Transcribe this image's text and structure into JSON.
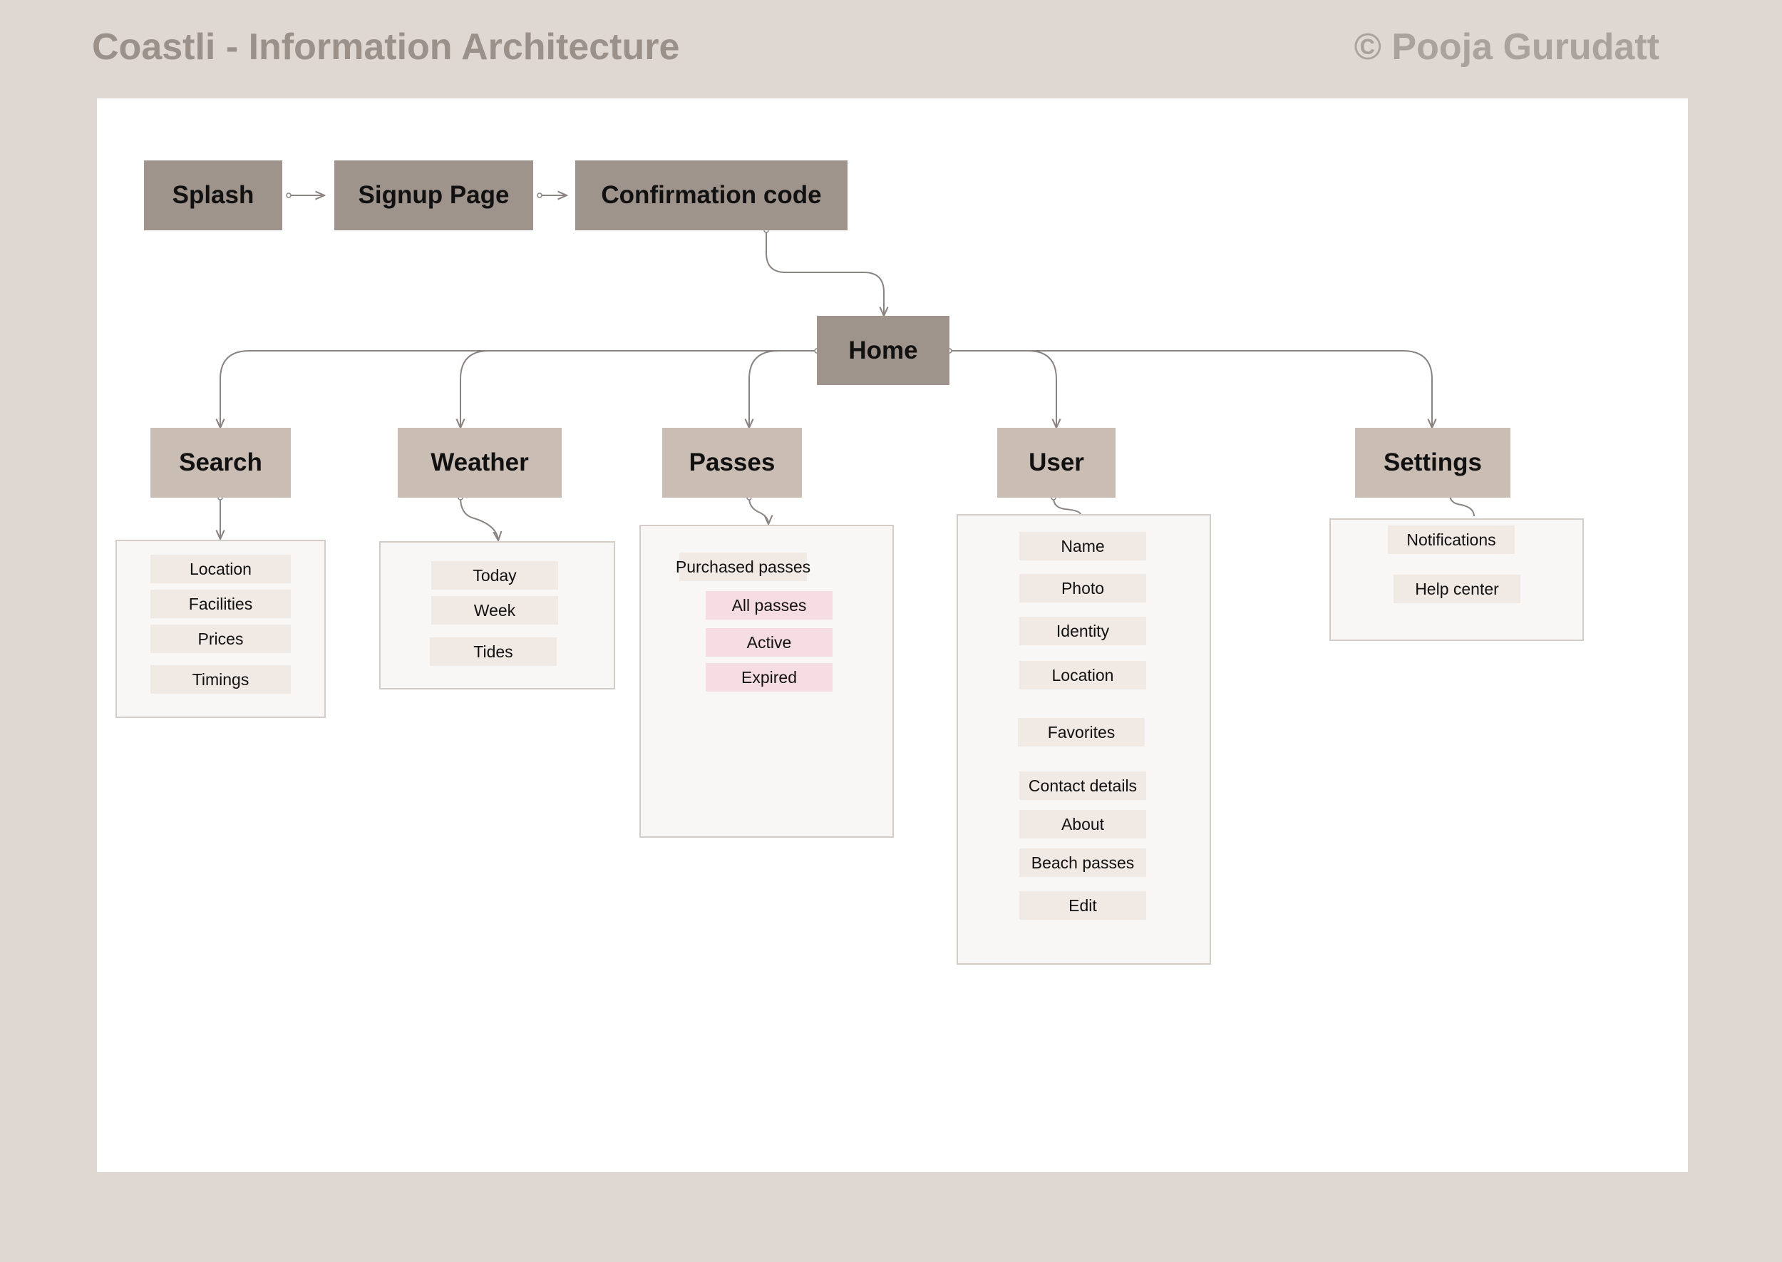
{
  "header": {
    "title": "Coastli - Information Architecture",
    "credit": "© Pooja Gurudatt"
  },
  "flow": {
    "splash": "Splash",
    "signup": "Signup Page",
    "confirmation": "Confirmation code",
    "home": "Home"
  },
  "sections": {
    "search": {
      "label": "Search",
      "items": [
        "Location",
        "Facilities",
        "Prices",
        "Timings"
      ]
    },
    "weather": {
      "label": "Weather",
      "items": [
        "Today",
        "Week",
        "Tides"
      ]
    },
    "passes": {
      "label": "Passes",
      "group_label": "Purchased passes",
      "items": [
        "All passes",
        "Active",
        "Expired"
      ]
    },
    "user": {
      "label": "User",
      "items": [
        "Name",
        "Photo",
        "Identity",
        "Location",
        "Favorites",
        "Contact details",
        "About",
        "Beach passes",
        "Edit"
      ]
    },
    "settings": {
      "label": "Settings",
      "items": [
        "Notifications",
        "Help center"
      ]
    }
  },
  "colors": {
    "background": "#dfd7d1",
    "primary_node": "#9e948c",
    "section_node": "#c9bdb4",
    "chip": "#f0e9e4",
    "chip_highlight": "#f6dce3",
    "connector": "#8a8380"
  }
}
